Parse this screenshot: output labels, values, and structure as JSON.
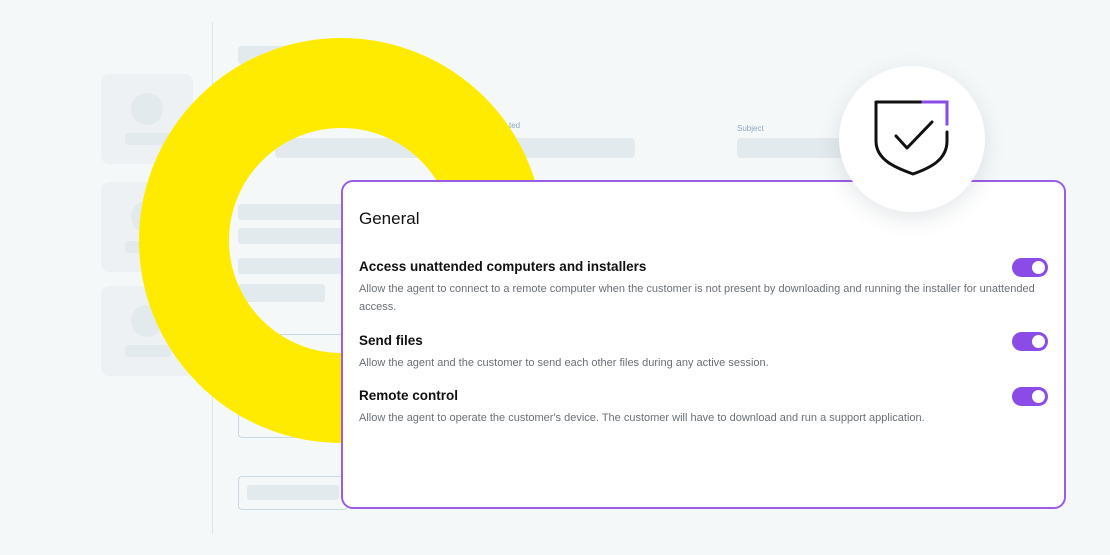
{
  "background": {
    "column_label_1": "ted",
    "column_label_2": "Subject"
  },
  "panel": {
    "title": "General",
    "settings": [
      {
        "title": "Access unattended computers and installers",
        "description": "Allow the agent to connect to a remote computer when the customer is not present by downloading and running the installer for unattended access.",
        "enabled": true
      },
      {
        "title": "Send files",
        "description": "Allow the agent and the customer to send each other files during any active session.",
        "enabled": true
      },
      {
        "title": "Remote control",
        "description": "Allow the agent to operate the customer's device. The customer will have to download and run a support application.",
        "enabled": true
      }
    ]
  },
  "colors": {
    "accent": "#8a4be6",
    "panel_border": "#9b5ce6",
    "ring": "#ffeb00",
    "background": "#f5f8f9"
  },
  "icons": {
    "badge": "shield-check-icon"
  }
}
